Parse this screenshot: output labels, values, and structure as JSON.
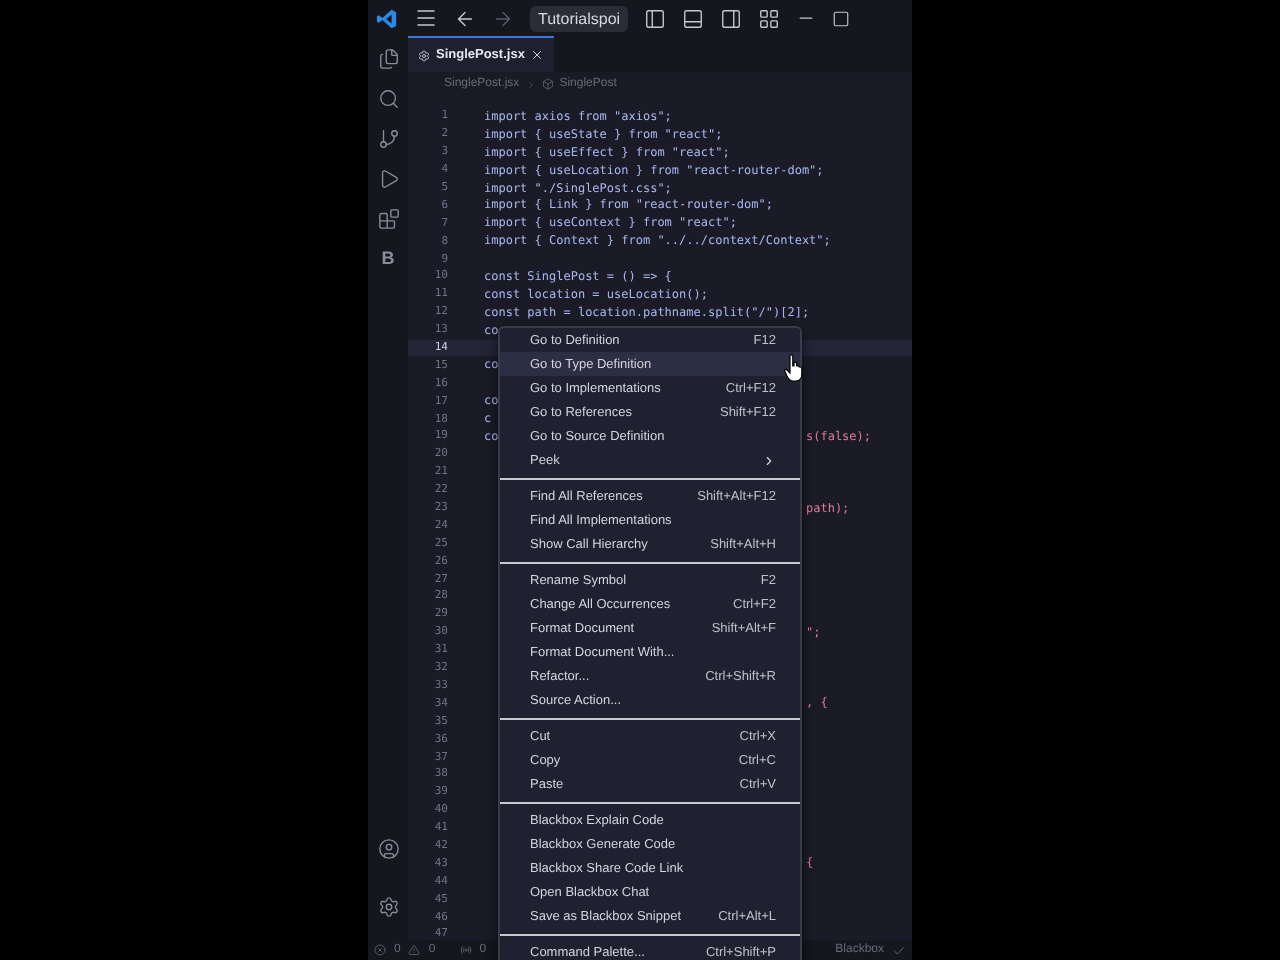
{
  "title_bar": {
    "search": "Tutorialspoi"
  },
  "activity_bar": {
    "extension_label": "B"
  },
  "tab": {
    "label": "SinglePost.jsx",
    "selected": true
  },
  "breadcrumb": [
    "SinglePost.jsx",
    "SinglePost"
  ],
  "editor": {
    "lines": [
      {
        "number": "1",
        "left": "import axios from \"axios\";"
      },
      {
        "number": "2",
        "left": "import { useState } from \"react\";"
      },
      {
        "number": "3",
        "left": "import { useEffect } from \"react\";"
      },
      {
        "number": "4",
        "left": "import { useLocation } from \"react-router-dom\";"
      },
      {
        "number": "5",
        "left": "import \"./SinglePost.css\";"
      },
      {
        "number": "6",
        "left": "import { Link } from \"react-router-dom\";"
      },
      {
        "number": "7",
        "left": "import { useContext } from \"react\";"
      },
      {
        "number": "8",
        "left": "import { Context } from \"../../context/Context\";"
      },
      {
        "number": "9"
      },
      {
        "number": "10",
        "left": "const SinglePost = () => {"
      },
      {
        "number": "11",
        "left": "const location = useLocation();"
      },
      {
        "number": "12",
        "left": "const path = location.pathname.split(\"/\")[2];"
      },
      {
        "number": "13",
        "left": "co"
      },
      {
        "number": "14",
        "current": true
      },
      {
        "number": "15",
        "left": "co"
      },
      {
        "number": "16"
      },
      {
        "number": "17",
        "left": "co"
      },
      {
        "number": "18",
        "left": " c"
      },
      {
        "number": "19",
        "left": "co",
        "right": "s(false);"
      },
      {
        "number": "20"
      },
      {
        "number": "21"
      },
      {
        "number": "22"
      },
      {
        "number": "23",
        "right": "path);"
      },
      {
        "number": "24"
      },
      {
        "number": "25"
      },
      {
        "number": "26"
      },
      {
        "number": "27"
      },
      {
        "number": "28"
      },
      {
        "number": "29"
      },
      {
        "number": "30",
        "right": "\";"
      },
      {
        "number": "31"
      },
      {
        "number": "32"
      },
      {
        "number": "33"
      },
      {
        "number": "34",
        "right": ", {"
      },
      {
        "number": "35"
      },
      {
        "number": "36"
      },
      {
        "number": "37"
      },
      {
        "number": "38"
      },
      {
        "number": "39"
      },
      {
        "number": "40"
      },
      {
        "number": "41"
      },
      {
        "number": "42"
      },
      {
        "number": "43",
        "right": "{"
      },
      {
        "number": "44"
      },
      {
        "number": "45"
      },
      {
        "number": "46"
      },
      {
        "number": "47"
      }
    ]
  },
  "context_menu": [
    {
      "kind": "item",
      "label": "Go to Definition",
      "shortcut": "F12",
      "selected": false
    },
    {
      "kind": "item",
      "label": "Go to Type Definition",
      "selected": true
    },
    {
      "kind": "item",
      "label": "Go to Implementations",
      "shortcut": "Ctrl+F12",
      "selected": false
    },
    {
      "kind": "item",
      "label": "Go to References",
      "shortcut": "Shift+F12",
      "selected": false
    },
    {
      "kind": "item",
      "label": "Go to Source Definition",
      "selected": false
    },
    {
      "kind": "submenu",
      "label": "Peek",
      "selected": false
    },
    {
      "kind": "separator"
    },
    {
      "kind": "item",
      "label": "Find All References",
      "shortcut": "Shift+Alt+F12",
      "selected": false
    },
    {
      "kind": "item",
      "label": "Find All Implementations",
      "selected": false
    },
    {
      "kind": "item",
      "label": "Show Call Hierarchy",
      "shortcut": "Shift+Alt+H",
      "selected": false
    },
    {
      "kind": "separator"
    },
    {
      "kind": "item",
      "label": "Rename Symbol",
      "shortcut": "F2",
      "selected": false
    },
    {
      "kind": "item",
      "label": "Change All Occurrences",
      "shortcut": "Ctrl+F2",
      "selected": false
    },
    {
      "kind": "item",
      "label": "Format Document",
      "shortcut": "Shift+Alt+F",
      "selected": false
    },
    {
      "kind": "item",
      "label": "Format Document With...",
      "selected": false
    },
    {
      "kind": "item",
      "label": "Refactor...",
      "shortcut": "Ctrl+Shift+R",
      "selected": false
    },
    {
      "kind": "item",
      "label": "Source Action...",
      "selected": false
    },
    {
      "kind": "separator"
    },
    {
      "kind": "item",
      "label": "Cut",
      "shortcut": "Ctrl+X",
      "selected": false
    },
    {
      "kind": "item",
      "label": "Copy",
      "shortcut": "Ctrl+C",
      "selected": false
    },
    {
      "kind": "item",
      "label": "Paste",
      "shortcut": "Ctrl+V",
      "selected": false
    },
    {
      "kind": "separator"
    },
    {
      "kind": "item",
      "label": "Blackbox Explain Code",
      "selected": false
    },
    {
      "kind": "item",
      "label": "Blackbox Generate Code",
      "selected": false
    },
    {
      "kind": "item",
      "label": "Blackbox Share Code Link",
      "selected": false
    },
    {
      "kind": "item",
      "label": "Open Blackbox Chat",
      "selected": false
    },
    {
      "kind": "item",
      "label": "Save as Blackbox Snippet",
      "shortcut": "Ctrl+Alt+L",
      "selected": false
    },
    {
      "kind": "separator"
    },
    {
      "kind": "item",
      "label": "Command Palette...",
      "shortcut": "Ctrl+Shift+P",
      "selected": false
    }
  ],
  "status_bar": {
    "errors": "0",
    "warnings": "0",
    "ports": "0",
    "extension": "Blackbox"
  }
}
